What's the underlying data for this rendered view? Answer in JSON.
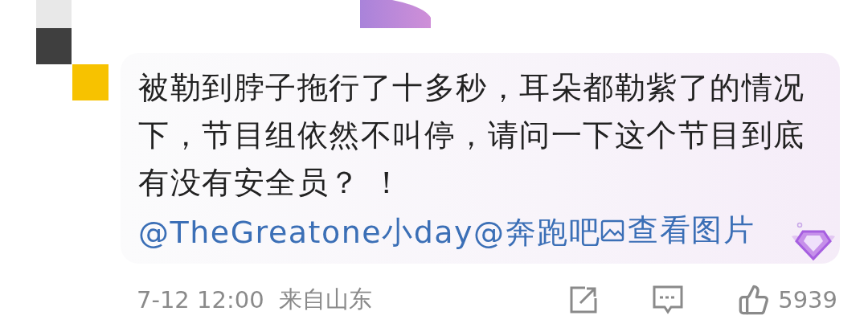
{
  "comment": {
    "body": [
      {
        "kind": "text",
        "text": "被勒到脖子拖行了十多秒，耳朵都勒紫了的情况下，节目组依然不叫停，请问一下这个节目到底有没有安全员？ ！ "
      },
      {
        "kind": "mention",
        "text": "@TheGreatone小day"
      },
      {
        "kind": "mention",
        "text": "@奔跑吧"
      },
      {
        "kind": "image_link",
        "text": "查看图片"
      }
    ],
    "time": "7-12 12:00",
    "location": "来自山东",
    "likes": "5939"
  }
}
